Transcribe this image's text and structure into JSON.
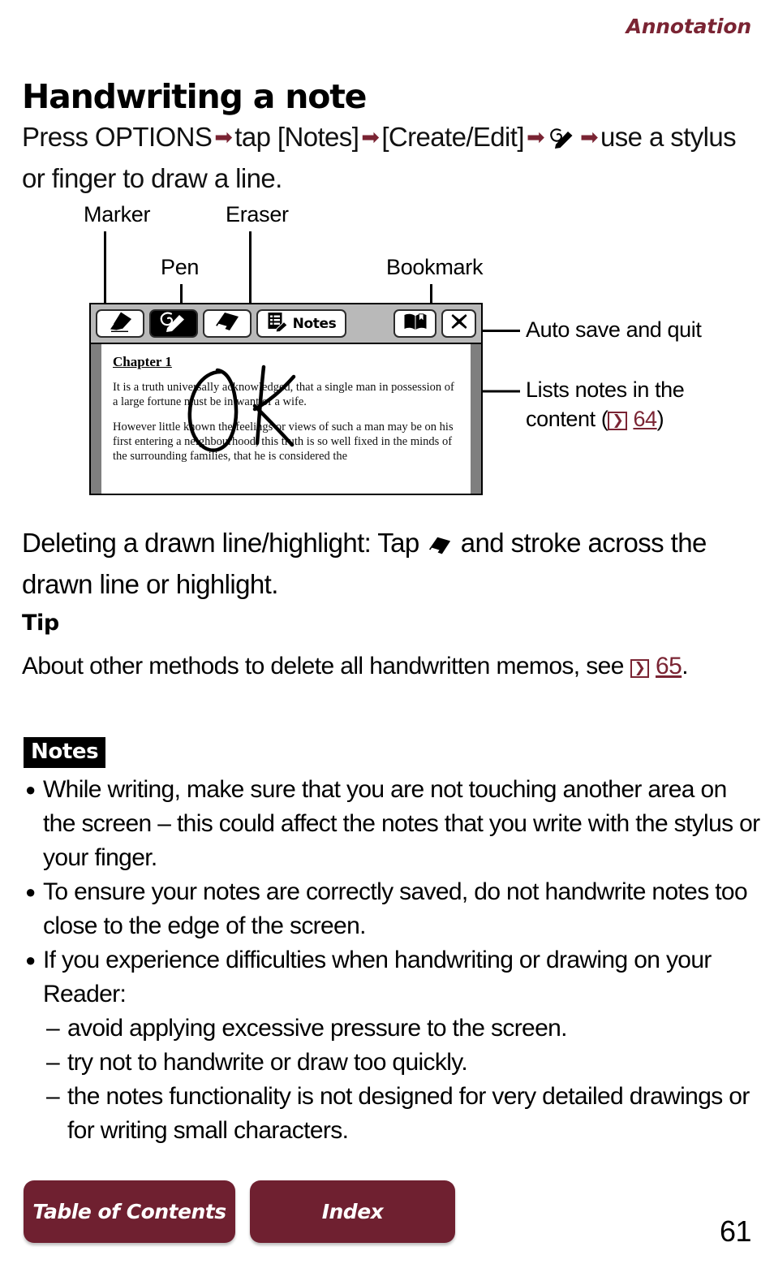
{
  "header": {
    "chapter": "Annotation"
  },
  "title": "Handwriting a note",
  "intro": {
    "part1": "Press OPTIONS",
    "part2": "tap [Notes]",
    "part3": "[Create/Edit]",
    "part4": "use a stylus or finger to draw a line."
  },
  "diagram": {
    "callouts": {
      "marker": "Marker",
      "pen": "Pen",
      "eraser": "Eraser",
      "bookmark": "Bookmark",
      "auto_save": "Auto save and quit",
      "lists_notes_line1": "Lists notes in the",
      "lists_notes_line2_pre": "content (",
      "lists_notes_ref_icon": "page-ref-icon",
      "lists_notes_page": "64",
      "lists_notes_line2_post": ")"
    },
    "toolbar": {
      "marker_icon": "marker-icon",
      "pen_icon": "pen-icon",
      "eraser_icon": "eraser-icon",
      "notes_icon": "notes-list-icon",
      "notes_label": "Notes",
      "bookmark_icon": "bookmark-icon",
      "close_icon": "close-icon"
    },
    "reader_page": {
      "chapter_title": "Chapter 1",
      "paragraph1": "It is a truth universally acknowledged, that a single man in possession of a large fortune must be in want of a wife.",
      "paragraph2": "However little known the feelings or views of such a man may be on his first entering a neighbourhood, this truth is so well fixed in the minds of the surrounding families, that he is considered the",
      "handwritten_ink": "OK"
    }
  },
  "deleting": {
    "text_pre": "Deleting a drawn line/highlight: Tap",
    "icon": "eraser-icon",
    "text_post": "and stroke across the drawn line or highlight."
  },
  "tip": {
    "heading": "Tip",
    "body_pre": "About other methods to delete all handwritten memos, see",
    "ref_icon": "page-ref-icon",
    "page": "65",
    "body_post": "."
  },
  "notes": {
    "badge": "Notes",
    "items": [
      "While writing, make sure that you are not touching another area on the screen – this could affect the notes that you write with the stylus or your finger.",
      "To ensure your notes are correctly saved, do not handwrite notes too close to the edge of the screen.",
      "If you experience difficulties when handwriting or drawing on your Reader:"
    ],
    "sub_items": [
      "avoid applying excessive pressure to the screen.",
      "try not to handwrite or draw too quickly.",
      "the notes functionality is not designed for very detailed drawings or for writing small characters."
    ],
    "bullet_glyph": "●",
    "dash_glyph": "–"
  },
  "footer": {
    "table_of_contents": "Table of Contents",
    "index": "Index",
    "page_number": "61"
  },
  "colors": {
    "accent": "#7a2433",
    "button": "#6f2030",
    "toolbar_bg": "#b9b9b9",
    "page_edge": "#7f7f7f"
  }
}
